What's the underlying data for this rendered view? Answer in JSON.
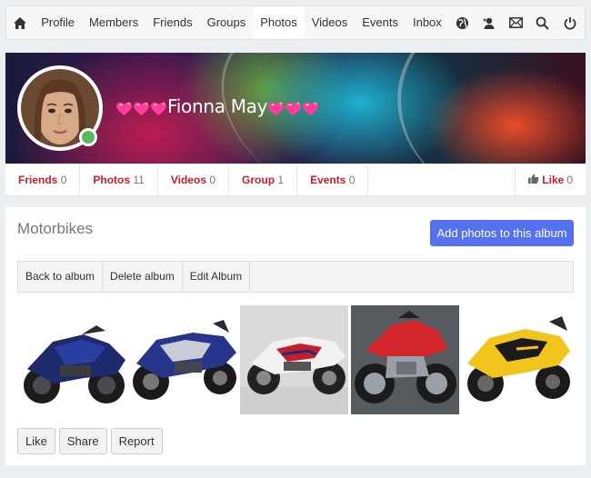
{
  "nav": {
    "home_icon": "home-icon",
    "links": [
      "Profile",
      "Members",
      "Friends",
      "Groups",
      "Photos",
      "Videos",
      "Events",
      "Inbox"
    ],
    "active": "Photos",
    "icons": [
      "globe-icon",
      "user-add-icon",
      "mail-icon",
      "search-icon"
    ],
    "power_icon": "power-icon"
  },
  "profile": {
    "name": "Fionna May",
    "online": true,
    "decoration": "sparkling-heart-emoji"
  },
  "stats": [
    {
      "label": "Friends",
      "count": "0"
    },
    {
      "label": "Photos",
      "count": "11"
    },
    {
      "label": "Videos",
      "count": "0"
    },
    {
      "label": "Group",
      "count": "1"
    },
    {
      "label": "Events",
      "count": "0"
    }
  ],
  "like": {
    "label": "Like",
    "count": "0",
    "icon": "thumbs-up-icon"
  },
  "album": {
    "title": "Motorbikes",
    "add_button": "Add photos to this album",
    "toolbar": [
      "Back to album",
      "Delete album",
      "Edit Album"
    ],
    "photos": [
      {
        "name": "blue Yamaha R1 side view",
        "body": "#1f2a6e",
        "accent": "#2b3fa3"
      },
      {
        "name": "blue Yamaha R1 three-quarter view",
        "body": "#27368a",
        "accent": "#c9ccd6"
      },
      {
        "name": "white Honda CBR red trim",
        "body": "#f2f2f2",
        "accent": "#c21e2c"
      },
      {
        "name": "red naked concept bike",
        "body": "#d3262c",
        "accent": "#9aa0a8"
      },
      {
        "name": "yellow Yamaha R6",
        "body": "#f2c51d",
        "accent": "#1b1b1b"
      }
    ],
    "actions": [
      "Like",
      "Share",
      "Report"
    ]
  },
  "colors": {
    "accent_red": "#c11d2e",
    "primary_button": "#5570f0",
    "online": "#5cb85c"
  }
}
